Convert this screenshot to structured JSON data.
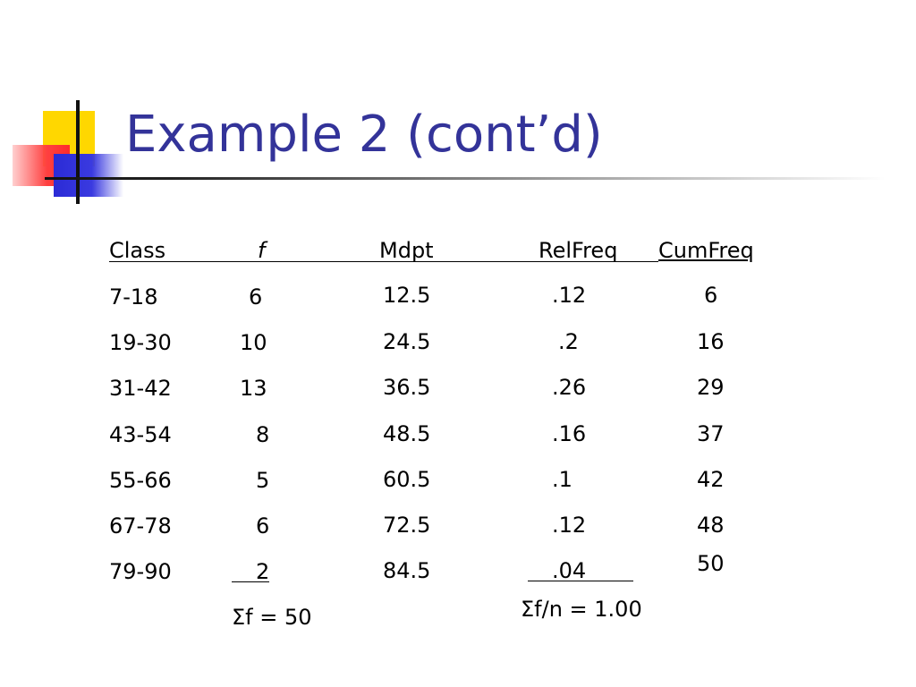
{
  "slide": {
    "title": "Example 2 (cont’d)"
  },
  "table": {
    "headers": {
      "class": "Class",
      "f": "f",
      "mdpt": "Mdpt",
      "relfreq": "RelFreq",
      "cumfreq": "CumFreq"
    },
    "rows": [
      {
        "class": "7-18",
        "f": "6",
        "mdpt": "12.5",
        "relfreq": ".12",
        "cumfreq": "6"
      },
      {
        "class": "19-30",
        "f": "10",
        "mdpt": "24.5",
        "relfreq": ".2",
        "cumfreq": "16"
      },
      {
        "class": "31-42",
        "f": "13",
        "mdpt": "36.5",
        "relfreq": ".26",
        "cumfreq": "29"
      },
      {
        "class": "43-54",
        "f": "8",
        "mdpt": "48.5",
        "relfreq": ".16",
        "cumfreq": "37"
      },
      {
        "class": "55-66",
        "f": "5",
        "mdpt": "60.5",
        "relfreq": ".1",
        "cumfreq": "42"
      },
      {
        "class": "67-78",
        "f": "6",
        "mdpt": "72.5",
        "relfreq": ".12",
        "cumfreq": "48"
      },
      {
        "class": "79-90",
        "f": "2",
        "mdpt": "84.5",
        "relfreq": ".04",
        "cumfreq": "50"
      }
    ],
    "sum_f": "Σf = 50",
    "sum_relfreq": "Σf/n = 1.00"
  },
  "colors": {
    "title": "#333399",
    "accent_yellow": "#ffd700",
    "accent_red": "#ff2b2b",
    "accent_blue": "#2b2bd6"
  }
}
